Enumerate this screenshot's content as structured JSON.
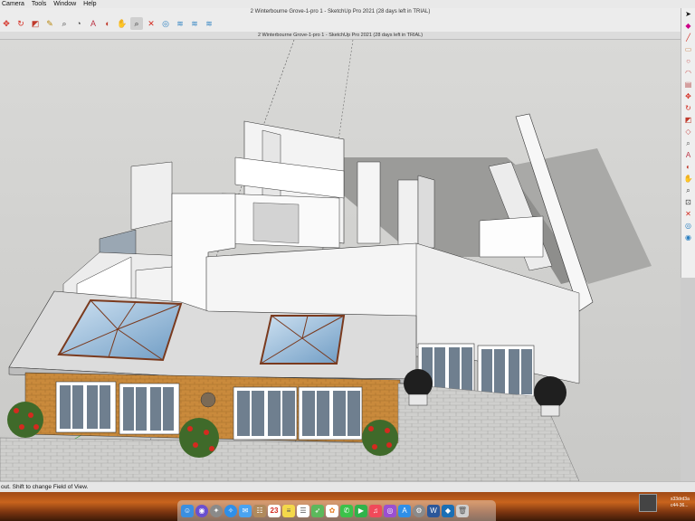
{
  "menubar": {
    "items": [
      "Camera",
      "Tools",
      "Window",
      "Help"
    ]
  },
  "window": {
    "title": "2 Winterbourne Grove-1-pro 1 - SketchUp Pro 2021 (28 days left in TRIAL)"
  },
  "tab": {
    "title": "2 Winterbourne Grove-1-pro 1 - SketchUp Pro 2021 (28 days left in TRIAL)"
  },
  "toolbar": {
    "icons": [
      "move-icon",
      "rotate-icon",
      "scale-icon",
      "paint-bucket-icon",
      "tape-measure-icon",
      "protractor-icon",
      "text-icon",
      "orbit-icon",
      "pan-icon",
      "zoom-icon",
      "zoom-extents-icon",
      "section-plane-icon",
      "display-section-planes-icon",
      "display-section-cuts-icon",
      "section-fill-icon"
    ]
  },
  "right_palette": {
    "icons": [
      "select-icon",
      "eraser-icon",
      "line-icon",
      "rectangle-icon",
      "circle-icon",
      "arc-icon",
      "pushpull-icon",
      "move-icon",
      "rotate-icon",
      "scale-icon",
      "offset-icon",
      "tape-icon",
      "text-icon",
      "orbit-icon",
      "pan-icon",
      "zoom-icon",
      "zoom-window-icon",
      "zoom-extents-icon",
      "walk-icon",
      "look-around-icon"
    ]
  },
  "status": {
    "text": "out. Shift to change Field of View."
  },
  "dock": {
    "apps": [
      "finder-icon",
      "siri-icon",
      "launchpad-icon",
      "safari-icon",
      "mail-icon",
      "contacts-icon",
      "calendar-icon",
      "notes-icon",
      "reminders-icon",
      "maps-icon",
      "photos-icon",
      "messages-icon",
      "facetime-icon",
      "music-icon",
      "podcasts-icon",
      "appstore-icon",
      "settings-icon",
      "word-icon",
      "sketchup-icon",
      "trash-icon"
    ],
    "calendar_day": "23"
  },
  "desktop": {
    "label_1": "s33drd3a",
    "label_2": "c44-36..."
  },
  "colors": {
    "accent_red": "#d42a1f",
    "roof_glass": "#8fb6d6",
    "brick": "#c98a3c",
    "paving": "#c9c9c9"
  }
}
